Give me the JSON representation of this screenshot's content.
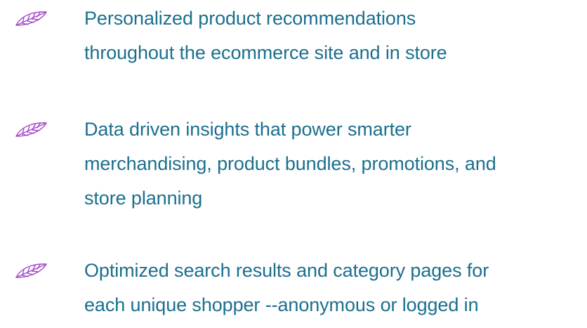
{
  "colors": {
    "text": "#1b6f8e",
    "leaf_icon": "#a24bc8"
  },
  "icons": [
    "leaf-icon",
    "leaf-icon",
    "leaf-icon"
  ],
  "items": [
    {
      "lines": [
        "Personalized product recommendations",
        "throughout the ecommerce site and in store"
      ]
    },
    {
      "lines": [
        "Data driven insights that power smarter",
        "merchandising, product bundles, promotions, and",
        "store planning"
      ]
    },
    {
      "lines": [
        "Optimized search results and category pages for",
        "each unique shopper --anonymous or logged in"
      ]
    }
  ]
}
